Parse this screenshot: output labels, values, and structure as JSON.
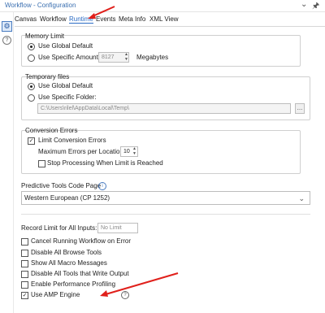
{
  "window": {
    "title": "Workflow - Configuration"
  },
  "title_icons": {
    "dropdown": "chevron-down-icon",
    "pin": "pin-icon"
  },
  "rail": {
    "settings_icon": "gear-icon",
    "help_icon": "help-icon"
  },
  "tabs": [
    {
      "label": "Canvas"
    },
    {
      "label": "Workflow"
    },
    {
      "label": "Runtime",
      "active": true
    },
    {
      "label": "Events"
    },
    {
      "label": "Meta Info"
    },
    {
      "label": "XML View"
    }
  ],
  "memory_limit": {
    "heading": "Memory Limit",
    "global_label": "Use Global Default",
    "specific_label": "Use Specific Amount:",
    "amount_value": "8127",
    "unit": "Megabytes"
  },
  "temp_files": {
    "heading": "Temporary files",
    "global_label": "Use Global Default",
    "specific_label": "Use Specific Folder:",
    "folder_value": "C:\\Users\\rilel\\AppData\\Local\\Temp\\",
    "browse_label": "..."
  },
  "conversion_errors": {
    "heading": "Conversion Errors",
    "limit_label": "Limit Conversion Errors",
    "max_label": "Maximum Errors per Location:",
    "max_value": "10",
    "stop_label": "Stop Processing When Limit is Reached"
  },
  "predictive": {
    "label": "Predictive Tools Code Page",
    "value": "Western European (CP 1252)"
  },
  "record_limit": {
    "label": "Record Limit for All Inputs:",
    "placeholder": "No Limit"
  },
  "options": [
    {
      "label": "Cancel Running Workflow on Error",
      "checked": false
    },
    {
      "label": "Disable All Browse Tools",
      "checked": false
    },
    {
      "label": "Show All Macro Messages",
      "checked": false
    },
    {
      "label": "Disable All Tools that Write Output",
      "checked": false
    },
    {
      "label": "Enable Performance Profiling",
      "checked": false
    },
    {
      "label": "Use AMP Engine",
      "checked": true
    }
  ],
  "annotations": {
    "arrow_color": "#e0201b"
  },
  "colors": {
    "accent": "#2b6cc4",
    "title_text": "#3a6fb0"
  }
}
